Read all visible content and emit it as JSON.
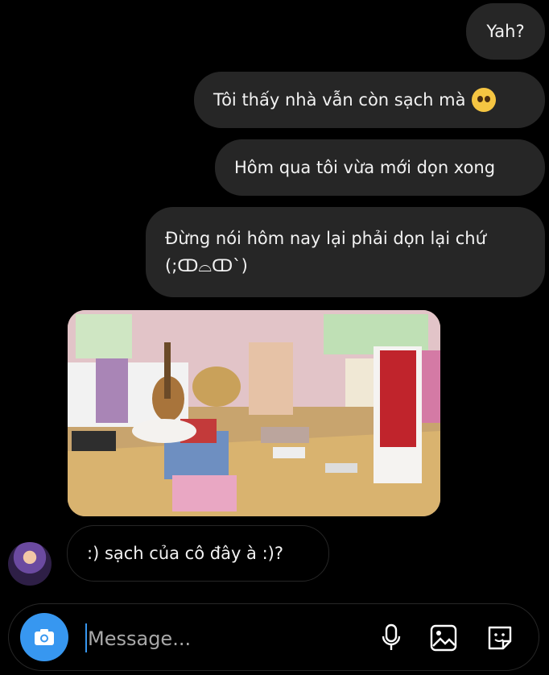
{
  "messages": {
    "sent": [
      {
        "text": "Yah?"
      },
      {
        "text": "Tôi thấy nhà vẫn còn sạch mà"
      },
      {
        "text": "Hôm qua tôi vừa mới dọn xong"
      },
      {
        "text": "Đừng nói hôm nay lại phải dọn lại chứ",
        "text2": "(;ↀ⌓ↀ`)"
      }
    ],
    "received": [
      {
        "text": ":) sạch của cô đây à :)?"
      }
    ]
  },
  "composer": {
    "placeholder": "Message..."
  },
  "icons": {
    "camera": "camera-icon",
    "mic": "microphone-icon",
    "gallery": "gallery-icon",
    "sticker": "sticker-icon",
    "emoji": "pleading-face-emoji"
  },
  "colors": {
    "background": "#000000",
    "bubble": "#262626",
    "camera_accent": "#3797f0",
    "placeholder": "#a8a8a8"
  }
}
